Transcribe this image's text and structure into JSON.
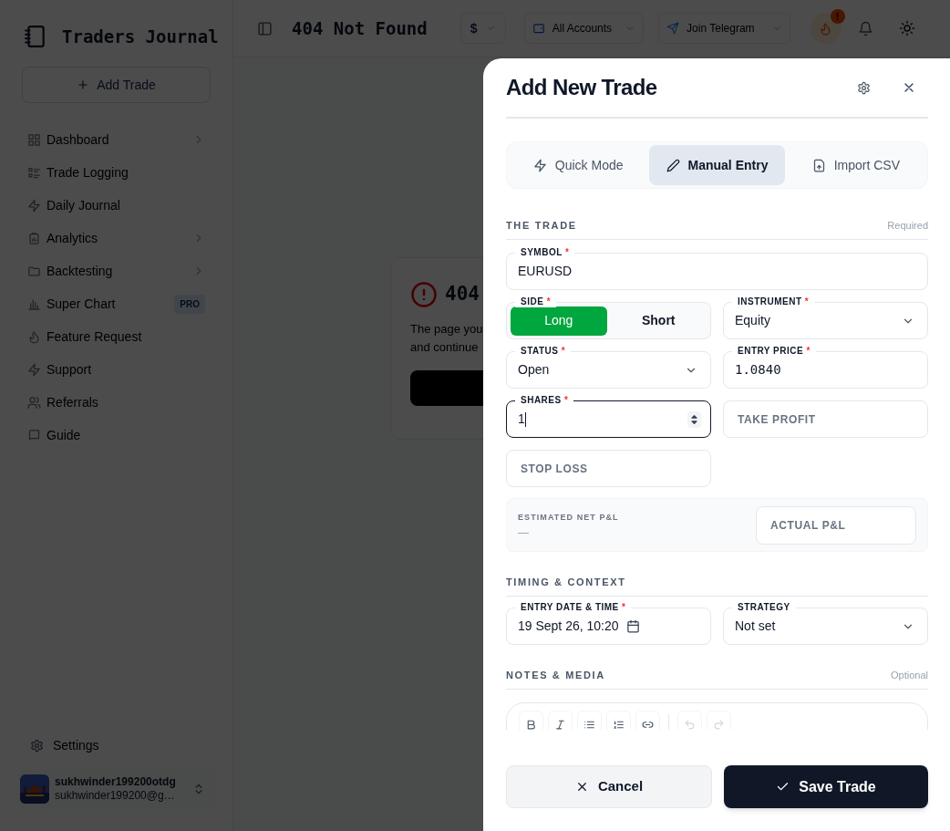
{
  "sidebar": {
    "brand": "Traders Journal",
    "add_button": "Add Trade",
    "items": [
      {
        "label": "Dashboard",
        "expandable": true
      },
      {
        "label": "Trade Logging",
        "expandable": false
      },
      {
        "label": "Daily Journal",
        "expandable": false
      },
      {
        "label": "Analytics",
        "expandable": true
      },
      {
        "label": "Backtesting",
        "expandable": true
      },
      {
        "label": "Super Chart",
        "expandable": false,
        "badge": "PRO"
      },
      {
        "label": "Feature Request",
        "expandable": false
      },
      {
        "label": "Support",
        "expandable": false
      },
      {
        "label": "Referrals",
        "expandable": false
      },
      {
        "label": "Guide",
        "expandable": false
      }
    ],
    "settings": "Settings",
    "user": {
      "name": "sukhwinder199200otdg",
      "email": "sukhwinder199200@g…"
    }
  },
  "header": {
    "title": "404 Not Found",
    "currency": "$",
    "account": "All Accounts",
    "telegram": "Join Telegram",
    "alert_badge": "!"
  },
  "not_found": {
    "code": "404",
    "lines": [
      "The page you",
      "and continue"
    ]
  },
  "dialog": {
    "title": "Add New Trade",
    "tabs": [
      {
        "label": "Quick Mode",
        "selected": false
      },
      {
        "label": "Manual Entry",
        "selected": true
      },
      {
        "label": "Import CSV",
        "selected": false
      }
    ],
    "trade_section": {
      "heading": "THE TRADE",
      "note": "Required",
      "fields": [
        {
          "kind": "text",
          "label": "SYMBOL",
          "required_mark": "*",
          "value": "EURUSD",
          "focused": false
        },
        {
          "kind": "toggle",
          "label": "SIDE",
          "required_mark": "*",
          "options": [
            {
              "label": "Long",
              "selected": true
            },
            {
              "label": "Short",
              "selected": false
            }
          ],
          "focused": false
        },
        {
          "kind": "select",
          "label": "INSTRUMENT",
          "required_mark": "*",
          "value": "Equity",
          "focused": false
        },
        {
          "kind": "select",
          "label": "STATUS",
          "required_mark": "*",
          "value": "Open",
          "focused": false
        },
        {
          "kind": "price",
          "label": "ENTRY PRICE",
          "required_mark": "*",
          "value": "1.0840",
          "focused": false
        },
        {
          "kind": "number",
          "label": "SHARES",
          "required_mark": "*",
          "value": "1",
          "focused": true
        },
        {
          "kind": "empty",
          "placeholder": "TAKE PROFIT",
          "focused": false
        },
        {
          "kind": "empty",
          "placeholder": "STOP LOSS",
          "focused": false
        }
      ],
      "pnl": {
        "label": "ESTIMATED NET P&L",
        "value": "—",
        "actual_placeholder": "ACTUAL P&L"
      }
    },
    "timing_section": {
      "heading": "TIMING & CONTEXT",
      "fields": [
        {
          "kind": "date",
          "label": "ENTRY DATE & TIME",
          "required_mark": "*",
          "value": "19 Sept 26, 10:20",
          "focused": false
        },
        {
          "kind": "select",
          "label": "STRATEGY",
          "value": "Not set",
          "focused": false
        }
      ]
    },
    "notes_section": {
      "heading": "NOTES & MEDIA",
      "note": "Optional",
      "tools": [
        {
          "disabled": false
        },
        {
          "disabled": false
        },
        {
          "disabled": false
        },
        {
          "disabled": false
        },
        {
          "disabled": false
        },
        {
          "disabled": true
        },
        {
          "disabled": true
        }
      ]
    },
    "cancel": "Cancel",
    "save": "Save Trade"
  }
}
